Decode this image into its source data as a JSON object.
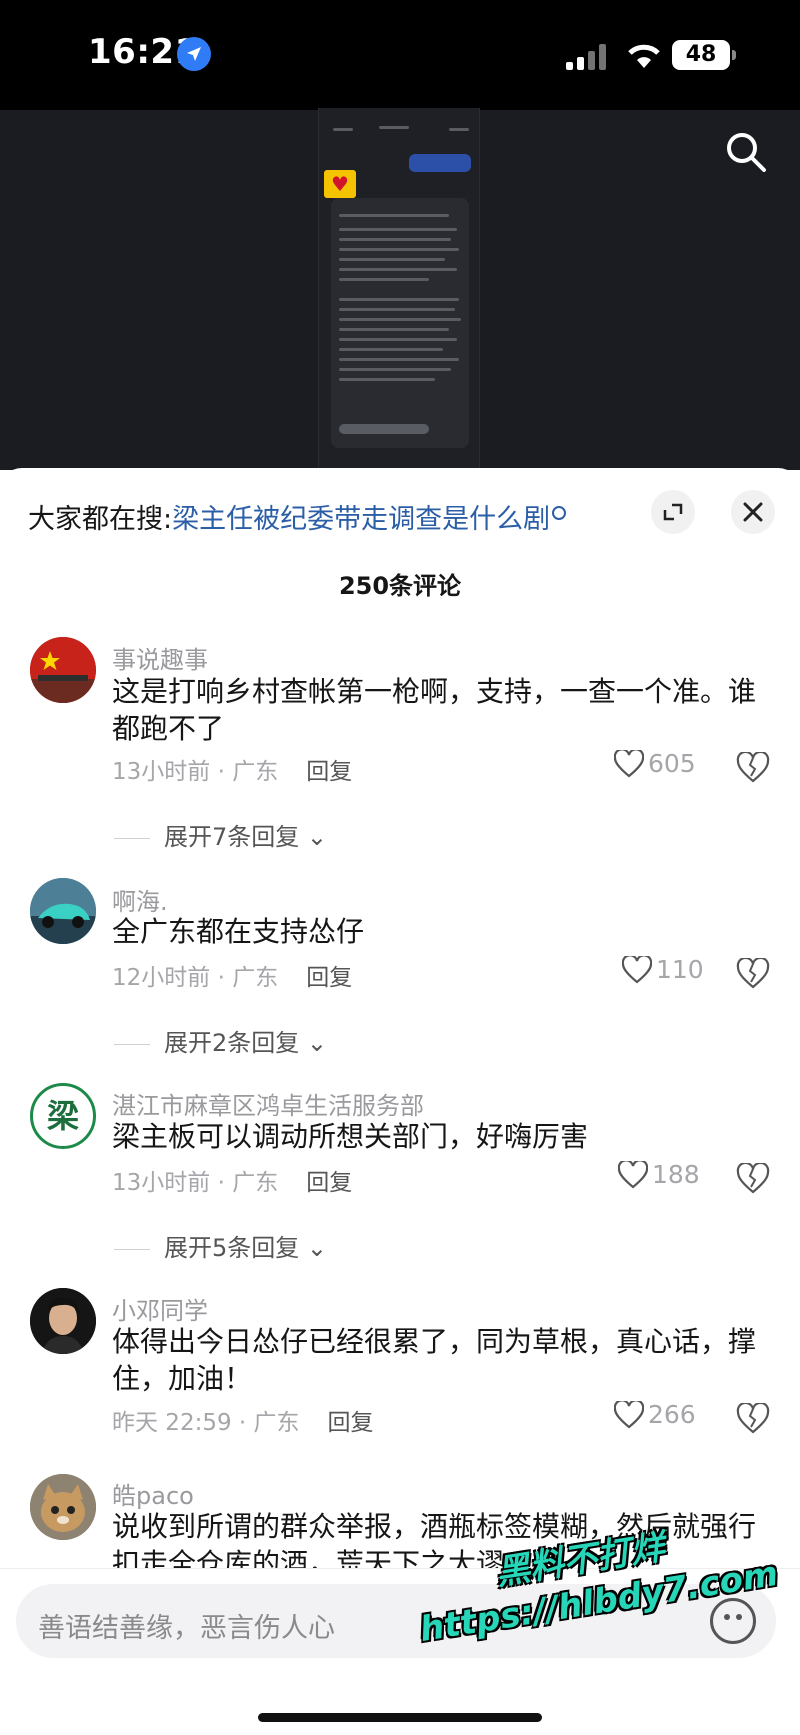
{
  "status_bar": {
    "time": "16:21",
    "battery": "48"
  },
  "trending": {
    "label": "大家都在搜:",
    "query": "梁主任被纪委带走调查是什么剧"
  },
  "comment_count": "250条评论",
  "comments": [
    {
      "user": "事说趣事",
      "text": "这是打响乡村查帐第一枪啊，支持，一查一个准。谁都跑不了",
      "time": "13小时前 · 广东",
      "reply": "回复",
      "likes": "605",
      "expand": "展开7条回复"
    },
    {
      "user": "啊海.",
      "text": "全广东都在支持怂仔",
      "time": "12小时前 · 广东",
      "reply": "回复",
      "likes": "110",
      "expand": "展开2条回复"
    },
    {
      "user": "湛江市麻章区鸿卓生活服务部",
      "text": "梁主板可以调动所想关部门，好嗨厉害",
      "time": "13小时前 · 广东",
      "reply": "回复",
      "likes": "188",
      "expand": "展开5条回复"
    },
    {
      "user": "小邓同学",
      "text": "体得出今日怂仔已经很累了，同为草根，真心话，撑住，加油！",
      "time": "昨天 22:59 · 广东",
      "reply": "回复",
      "likes": "266"
    },
    {
      "user": "皓paco",
      "text": "说收到所谓的群众举报，酒瓶标签模糊，然后就强行扣走全仓库的酒，荒天下之大谬"
    }
  ],
  "avatar_text": "梁",
  "input_placeholder": "善语结善缘，恶言伤人心",
  "watermark": {
    "line1": "黑料不打烊",
    "line2": "https://hlbdy7.com"
  },
  "colors": {
    "link": "#2b5ea7",
    "meta": "#a6a6aa",
    "accent_blue": "#2f7cf6"
  }
}
